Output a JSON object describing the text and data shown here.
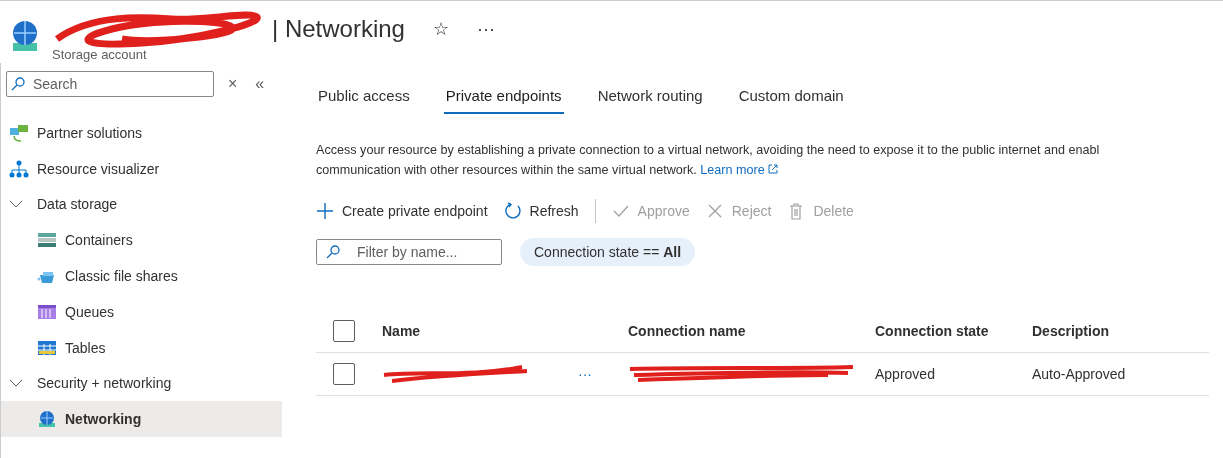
{
  "header": {
    "title": "| Networking",
    "subtitle": "Storage account",
    "favorite": "☆",
    "more": "···"
  },
  "sidebar": {
    "search": {
      "placeholder": "Search"
    },
    "clear": "×",
    "collapse": "«",
    "items": [
      {
        "label": "Partner solutions",
        "kind": "item",
        "selected": false
      },
      {
        "label": "Resource visualizer",
        "kind": "item",
        "selected": false
      },
      {
        "label": "Data storage",
        "kind": "group",
        "expanded": true,
        "children": [
          {
            "label": "Containers",
            "kind": "item",
            "selected": false
          },
          {
            "label": "Classic file shares",
            "kind": "item",
            "selected": false
          },
          {
            "label": "Queues",
            "kind": "item",
            "selected": false
          },
          {
            "label": "Tables",
            "kind": "item",
            "selected": false
          }
        ]
      },
      {
        "label": "Security + networking",
        "kind": "group",
        "expanded": true,
        "children": [
          {
            "label": "Networking",
            "kind": "item",
            "selected": true
          }
        ]
      }
    ]
  },
  "tabs": [
    {
      "label": "Public access",
      "selected": false
    },
    {
      "label": "Private endpoints",
      "selected": true
    },
    {
      "label": "Network routing",
      "selected": false
    },
    {
      "label": "Custom domain",
      "selected": false
    }
  ],
  "description": {
    "line_1": "Access your resource by establishing a private connection to a virtual network, avoiding the need to expose it to the public internet and enabl",
    "line_2": "communication with other resources within the same virtual network.",
    "link": "Learn more"
  },
  "toolbar": [
    {
      "label": "Create private endpoint",
      "kind": "button",
      "disabled": false
    },
    {
      "label": "Refresh",
      "kind": "button",
      "disabled": false
    },
    {
      "kind": "separator"
    },
    {
      "label": "Approve",
      "kind": "button",
      "disabled": true
    },
    {
      "label": "Reject",
      "kind": "button",
      "disabled": true
    },
    {
      "label": "Delete",
      "kind": "button",
      "disabled": true
    }
  ],
  "filter": {
    "placeholder": "Filter by name...",
    "pill": "Connection state == **All**"
  },
  "table": {
    "select_all_checked": false,
    "columns": [
      "Name",
      "Connection name",
      "Connection state",
      "Description"
    ],
    "rows": [
      {
        "checked": false,
        "more": "···",
        "connection_state": "Approved",
        "description": "Auto-Approved"
      }
    ]
  }
}
